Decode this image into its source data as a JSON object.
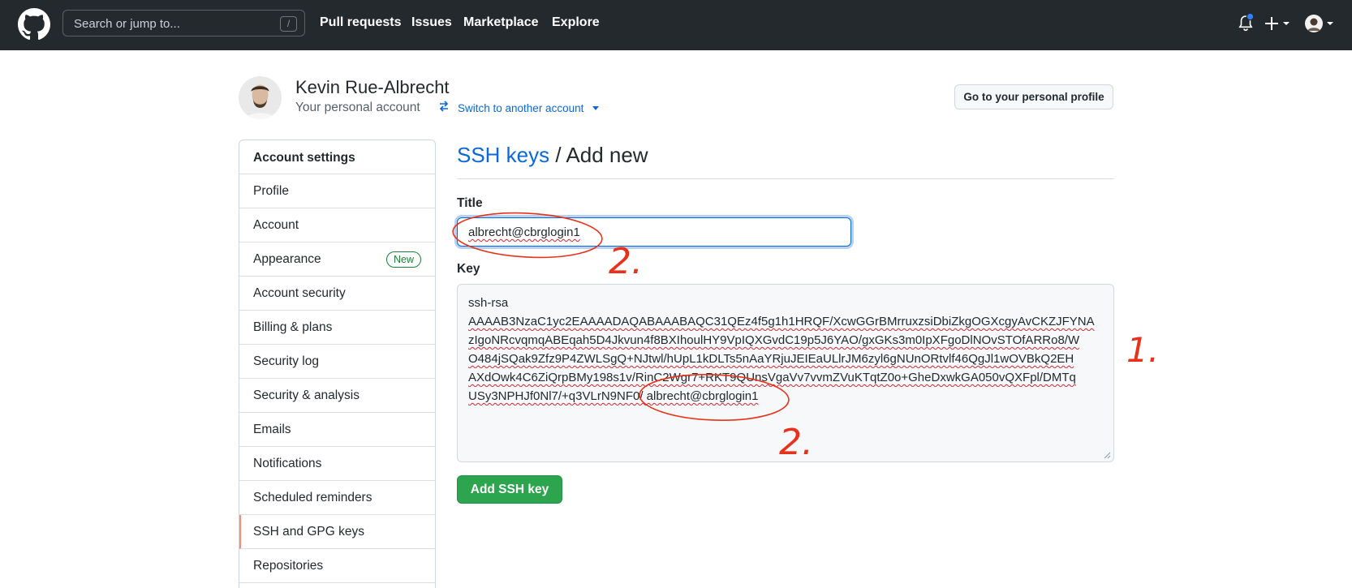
{
  "header": {
    "search_placeholder": "Search or jump to...",
    "search_shortcut": "/",
    "nav": [
      "Pull requests",
      "Issues",
      "Marketplace",
      "Explore"
    ]
  },
  "profile": {
    "name": "Kevin Rue-Albrecht",
    "subtitle": "Your personal account",
    "switch_link": "Switch to another account",
    "go_profile_button": "Go to your personal profile"
  },
  "sidebar": {
    "heading": "Account settings",
    "items": [
      {
        "label": "Profile"
      },
      {
        "label": "Account"
      },
      {
        "label": "Appearance",
        "badge": "New"
      },
      {
        "label": "Account security"
      },
      {
        "label": "Billing & plans"
      },
      {
        "label": "Security log"
      },
      {
        "label": "Security & analysis"
      },
      {
        "label": "Emails"
      },
      {
        "label": "Notifications"
      },
      {
        "label": "Scheduled reminders"
      },
      {
        "label": "SSH and GPG keys",
        "active": true
      },
      {
        "label": "Repositories"
      }
    ]
  },
  "main": {
    "heading_link": "SSH keys",
    "heading_rest": " / Add new",
    "title_label": "Title",
    "title_value": "albrecht@cbrglogin1",
    "key_label": "Key",
    "key_lines": [
      "ssh-rsa",
      "AAAAB3NzaC1yc2EAAAADAQABAAABAQC31QEz4f5g1h1HRQF/XcwGGrBMrruxzsiDbiZkgOGXcgyAvCKZJFYNA",
      "zIgoNRcvqmqABEqah5D4Jkvun4f8BXIhoulHY9VpIQXGvdC19p5J6YAO/gxGKs3m0IpXFgoDlNOvSTOfARRo8/W",
      "O484jSQak9Zfz9P4ZWLSgQ+NJtwl/hUpL1kDLTs5nAaYRjuJEIEaULlrJM6zyl6gNUnORtvlf46QgJl1wOVBkQ2EH",
      "AXdOwk4C6ZiQrpBMy198s1v/RinC2Wgr7+RKT9QUnsVgaVv7vvmZVuKTqtZ0o+GheDxwkGA050vQXFpl/DMTq",
      "USy3NPHJf0Nl7/+q3VLrN9NF0/ albrecht@cbrglogin1"
    ],
    "add_button": "Add SSH key"
  },
  "annotations": {
    "marks": [
      "1.",
      "2.",
      "2."
    ],
    "color": "#e8311a"
  },
  "colors": {
    "header_bg": "#24292e",
    "link": "#0969da",
    "primary_button": "#2da44e",
    "active_marker": "#fd8c73"
  }
}
